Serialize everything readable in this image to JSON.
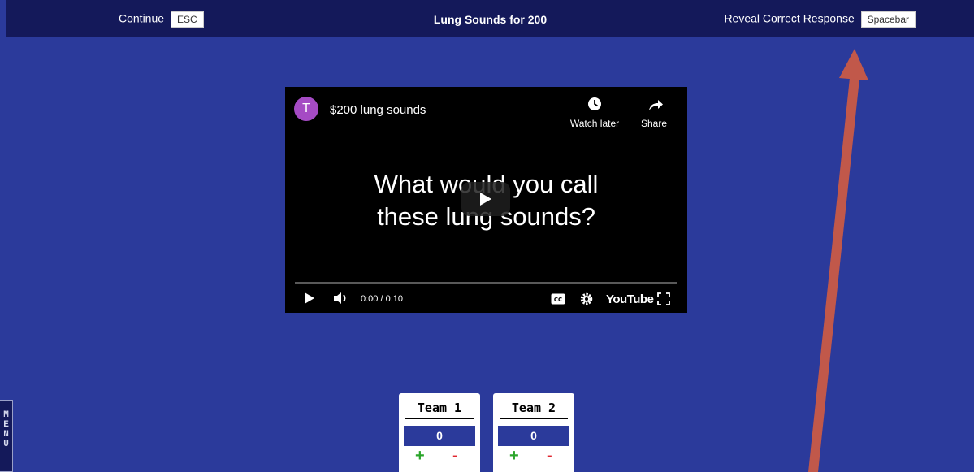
{
  "topbar": {
    "continue_label": "Continue",
    "continue_key": "ESC",
    "title": "Lung Sounds for 200",
    "reveal_label": "Reveal Correct Response",
    "reveal_key": "Spacebar"
  },
  "video": {
    "channel_initial": "T",
    "title": "$200 lung sounds",
    "watch_later_label": "Watch later",
    "share_label": "Share",
    "question_line1": "What would you call",
    "question_line2": "these lung sounds?",
    "time": "0:00 / 0:10",
    "brand": "YouTube",
    "progress": 0
  },
  "teams": [
    {
      "name": "Team 1",
      "score": "0",
      "plus": "+",
      "minus": "-"
    },
    {
      "name": "Team 2",
      "score": "0",
      "plus": "+",
      "minus": "-"
    }
  ],
  "menu": {
    "letters": [
      "M",
      "E",
      "N",
      "U"
    ]
  },
  "colors": {
    "background": "#2b3a9b",
    "topbar": "#14195a",
    "arrow": "#c1584a",
    "plus": "#2aa52a",
    "minus": "#e0262f"
  }
}
